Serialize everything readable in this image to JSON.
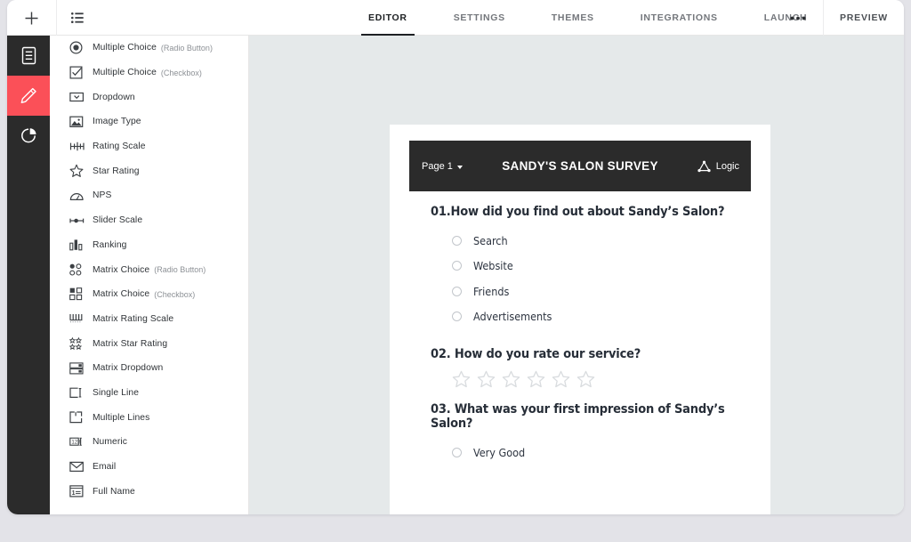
{
  "topbar": {
    "add_icon": "plus-icon",
    "list_icon": "list-view-icon",
    "tabs": [
      {
        "label": "EDITOR",
        "active": true
      },
      {
        "label": "SETTINGS",
        "active": false
      },
      {
        "label": "THEMES",
        "active": false
      },
      {
        "label": "INTEGRATIONS",
        "active": false
      },
      {
        "label": "LAUNCH",
        "active": false
      }
    ],
    "more_label": "•••",
    "preview_label": "PREVIEW"
  },
  "rail": {
    "items": [
      {
        "icon": "document-icon",
        "active": false
      },
      {
        "icon": "pencil-edit-icon",
        "active": true
      },
      {
        "icon": "pie-chart-icon",
        "active": false
      }
    ],
    "active_color": "#fb5058",
    "background": "#2b2b2b"
  },
  "sidebar": {
    "items": [
      {
        "label": "Multiple Choice",
        "sub": "(Radio Button)",
        "icon": "radio-button-icon"
      },
      {
        "label": "Multiple Choice",
        "sub": "(Checkbox)",
        "icon": "checkbox-icon"
      },
      {
        "label": "Dropdown",
        "sub": "",
        "icon": "dropdown-icon"
      },
      {
        "label": "Image Type",
        "sub": "",
        "icon": "image-icon"
      },
      {
        "label": "Rating Scale",
        "sub": "",
        "icon": "rating-scale-icon"
      },
      {
        "label": "Star Rating",
        "sub": "",
        "icon": "star-icon"
      },
      {
        "label": "NPS",
        "sub": "",
        "icon": "gauge-icon"
      },
      {
        "label": "Slider Scale",
        "sub": "",
        "icon": "slider-icon"
      },
      {
        "label": "Ranking",
        "sub": "",
        "icon": "bar-ranking-icon"
      },
      {
        "label": "Matrix Choice",
        "sub": "(Radio Button)",
        "icon": "matrix-radio-icon"
      },
      {
        "label": "Matrix Choice",
        "sub": "(Checkbox)",
        "icon": "matrix-checkbox-icon"
      },
      {
        "label": "Matrix Rating Scale",
        "sub": "",
        "icon": "matrix-rating-icon"
      },
      {
        "label": "Matrix Star Rating",
        "sub": "",
        "icon": "matrix-star-icon"
      },
      {
        "label": "Matrix Dropdown",
        "sub": "",
        "icon": "matrix-dropdown-icon"
      },
      {
        "label": "Single Line",
        "sub": "",
        "icon": "single-line-icon"
      },
      {
        "label": "Multiple Lines",
        "sub": "",
        "icon": "multiple-lines-icon"
      },
      {
        "label": "Numeric",
        "sub": "",
        "icon": "numeric-icon"
      },
      {
        "label": "Email",
        "sub": "",
        "icon": "email-icon"
      },
      {
        "label": "Full Name",
        "sub": "",
        "icon": "full-name-icon"
      }
    ]
  },
  "survey": {
    "page_selector": "Page 1",
    "title": "SANDY'S SALON SURVEY",
    "logic_label": "Logic",
    "logic_icon": "logic-triangle-icon",
    "questions": [
      {
        "number": "01.",
        "text": "How did you find out about Sandy’s Salon?",
        "title": "01.How did you find out about Sandy’s Salon?",
        "type": "radio",
        "options": [
          "Search",
          "Website",
          "Friends",
          "Advertisements"
        ]
      },
      {
        "number": "02.",
        "text": "How do you rate our service?",
        "title": "02. How do you rate our service?",
        "type": "star",
        "star_count": 6,
        "options": []
      },
      {
        "number": "03.",
        "text": "What was your first impression of Sandy’s Salon?",
        "title": "03. What was your first impression of Sandy’s Salon?",
        "type": "radio",
        "options": [
          "Very Good"
        ]
      }
    ]
  }
}
